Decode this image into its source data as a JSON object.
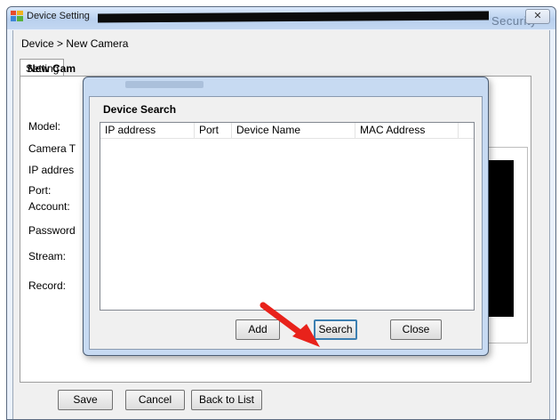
{
  "window": {
    "title": "Device Setting",
    "ghost_title_text": "Security",
    "close_glyph": "✕"
  },
  "breadcrumb": "Device > New Camera",
  "tabs": [
    {
      "label": "Setting"
    }
  ],
  "form": {
    "title": "New Cam",
    "labels": {
      "model": "Model:",
      "camera_type": "Camera T",
      "ip_address": "IP addres",
      "port": "Port:",
      "account": "Account:",
      "password": "Password",
      "stream": "Stream:",
      "record": "Record:"
    }
  },
  "footer_buttons": {
    "save": "Save",
    "cancel": "Cancel",
    "back": "Back to List"
  },
  "dialog": {
    "title": "Device Search",
    "columns": [
      "IP address",
      "Port",
      "Device Name",
      "MAC Address"
    ],
    "rows": [],
    "buttons": {
      "add": "Add",
      "search": "Search",
      "close": "Close"
    }
  },
  "colors": {
    "annotation_arrow": "#e8221b",
    "focused_button_border": "#3c7fb1"
  },
  "icons": {
    "app": "device-setting-app-icon",
    "close": "close-icon",
    "annotation": "red-arrow-annotation"
  }
}
